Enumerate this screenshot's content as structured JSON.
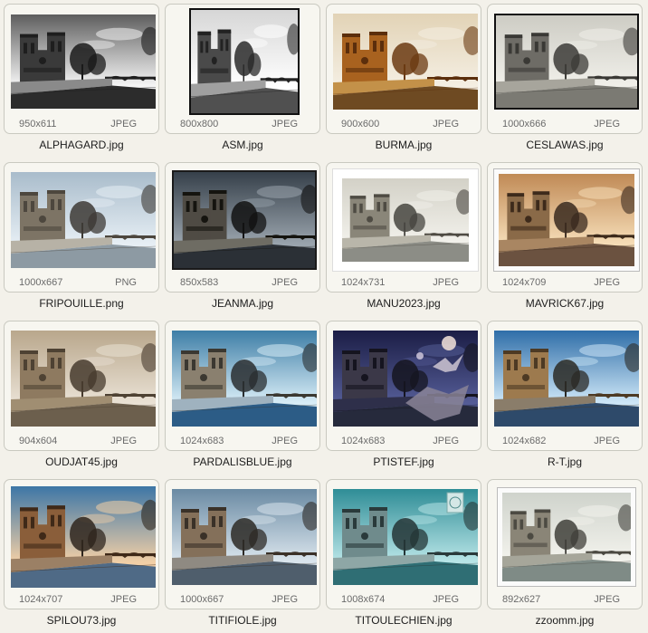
{
  "thumbnails": [
    {
      "filename": "ALPHAGARD.jpg",
      "dimensions": "950x611",
      "format": "JPEG",
      "style": "bw"
    },
    {
      "filename": "ASM.jpg",
      "dimensions": "800x800",
      "format": "JPEG",
      "style": "bwsquare"
    },
    {
      "filename": "BURMA.jpg",
      "dimensions": "900x600",
      "format": "JPEG",
      "style": "sepia"
    },
    {
      "filename": "CESLAWAS.jpg",
      "dimensions": "1000x666",
      "format": "JPEG",
      "style": "greyframe"
    },
    {
      "filename": "FRIPOUILLE.png",
      "dimensions": "1000x667",
      "format": "PNG",
      "style": "pale"
    },
    {
      "filename": "JEANMA.jpg",
      "dimensions": "850x583",
      "format": "JPEG",
      "style": "darkframe"
    },
    {
      "filename": "MANU2023.jpg",
      "dimensions": "1024x731",
      "format": "JPEG",
      "style": "whiteframe"
    },
    {
      "filename": "MAVRICK67.jpg",
      "dimensions": "1024x709",
      "format": "JPEG",
      "style": "warm"
    },
    {
      "filename": "OUDJAT45.jpg",
      "dimensions": "904x604",
      "format": "JPEG",
      "style": "brown"
    },
    {
      "filename": "PARDALISBLUE.jpg",
      "dimensions": "1024x683",
      "format": "JPEG",
      "style": "blue"
    },
    {
      "filename": "PTISTEF.jpg",
      "dimensions": "1024x683",
      "format": "JPEG",
      "style": "purple"
    },
    {
      "filename": "R-T.jpg",
      "dimensions": "1024x682",
      "format": "JPEG",
      "style": "colorful"
    },
    {
      "filename": "SPILOU73.jpg",
      "dimensions": "1024x707",
      "format": "JPEG",
      "style": "sunset"
    },
    {
      "filename": "TITIFIOLE.jpg",
      "dimensions": "1000x667",
      "format": "JPEG",
      "style": "cloudy"
    },
    {
      "filename": "TITOULECHIEN.jpg",
      "dimensions": "1008x674",
      "format": "JPEG",
      "style": "teal"
    },
    {
      "filename": "zzoomm.jpg",
      "dimensions": "892x627",
      "format": "JPEG",
      "style": "vignette"
    }
  ],
  "palettes": {
    "bw": {
      "sky1": "#f4f4f4",
      "sky2": "#5e5e5e",
      "building": "#3a3a3a",
      "shade": "#1e1e1e",
      "ground": "#8a8a8a",
      "water": "#2c2c2c",
      "tree": "#1a1a1a"
    },
    "bwsquare": {
      "sky1": "#ffffff",
      "sky2": "#d6d6d6",
      "building": "#4a4a4a",
      "shade": "#222222",
      "ground": "#a0a0a0",
      "water": "#505050",
      "tree": "#2a2a2a"
    },
    "sepia": {
      "sky1": "#f4eee2",
      "sky2": "#e2d3b6",
      "building": "#a8621f",
      "shade": "#5b2e0c",
      "ground": "#c39149",
      "water": "#6e4a22",
      "tree": "#6b3a12"
    },
    "greyframe": {
      "sky1": "#f0efe9",
      "sky2": "#cdccc4",
      "building": "#6e6c66",
      "shade": "#3a3935",
      "ground": "#a7a59c",
      "water": "#7b7a73",
      "tree": "#3c3b37"
    },
    "pale": {
      "sky1": "#e6eef4",
      "sky2": "#a9bccb",
      "building": "#7d7465",
      "shade": "#4d473e",
      "ground": "#b7b2a6",
      "water": "#8d9aa3",
      "tree": "#3d3a35"
    },
    "darkframe": {
      "sky1": "#9aa4ad",
      "sky2": "#36404a",
      "building": "#4f4b44",
      "shade": "#15140f",
      "ground": "#6e6c63",
      "water": "#2b3036",
      "tree": "#121212"
    },
    "whiteframe": {
      "sky1": "#f1f0ea",
      "sky2": "#d3d1c7",
      "building": "#8a8679",
      "shade": "#4e4b43",
      "ground": "#b9b6aa",
      "water": "#8c8d86",
      "tree": "#474540"
    },
    "warm": {
      "sky1": "#f5dcb6",
      "sky2": "#c08a56",
      "building": "#8a6a48",
      "shade": "#3d2a1b",
      "ground": "#a98662",
      "water": "#6b5240",
      "tree": "#3a2a1f"
    },
    "brown": {
      "sky1": "#e9e1d4",
      "sky2": "#b9a78c",
      "building": "#8e7a60",
      "shade": "#4e4233",
      "ground": "#a08e72",
      "water": "#6c5f4d",
      "tree": "#473b2e"
    },
    "blue": {
      "sky1": "#d7ecf6",
      "sky2": "#3e7ea6",
      "building": "#8a806f",
      "shade": "#3b3831",
      "ground": "#9fb2bf",
      "water": "#2c5c86",
      "tree": "#2a2e30"
    },
    "purple": {
      "sky1": "#545c96",
      "sky2": "#1b1d45",
      "building": "#3b3848",
      "shade": "#15141f",
      "ground": "#2e2f4a",
      "water": "#262a3c",
      "tree": "#151520"
    },
    "colorful": {
      "sky1": "#cde6f7",
      "sky2": "#2f6ea8",
      "building": "#9d7a4e",
      "shade": "#4d3a24",
      "ground": "#8a7d6a",
      "water": "#2e4a6a",
      "tree": "#2b2a25"
    },
    "sunset": {
      "sky1": "#f2cfa6",
      "sky2": "#3d76a6",
      "building": "#8a5e3a",
      "shade": "#3f2918",
      "ground": "#9b8065",
      "water": "#4f6a86",
      "tree": "#2f261d"
    },
    "cloudy": {
      "sky1": "#d9e4ec",
      "sky2": "#6a8aa3",
      "building": "#84705a",
      "shade": "#3a3128",
      "ground": "#8f8a82",
      "water": "#4f5e6c",
      "tree": "#2d2a26"
    },
    "teal": {
      "sky1": "#b7e4e6",
      "sky2": "#2f8d96",
      "building": "#6f8b8c",
      "shade": "#2a3a3b",
      "ground": "#8ea7a6",
      "water": "#2f6e74",
      "tree": "#243536"
    },
    "vignette": {
      "sky1": "#f2f2ec",
      "sky2": "#cfd3cc",
      "building": "#8a8577",
      "shade": "#4c4a42",
      "ground": "#a6a69a",
      "water": "#7f8b86",
      "tree": "#403f3a"
    }
  }
}
